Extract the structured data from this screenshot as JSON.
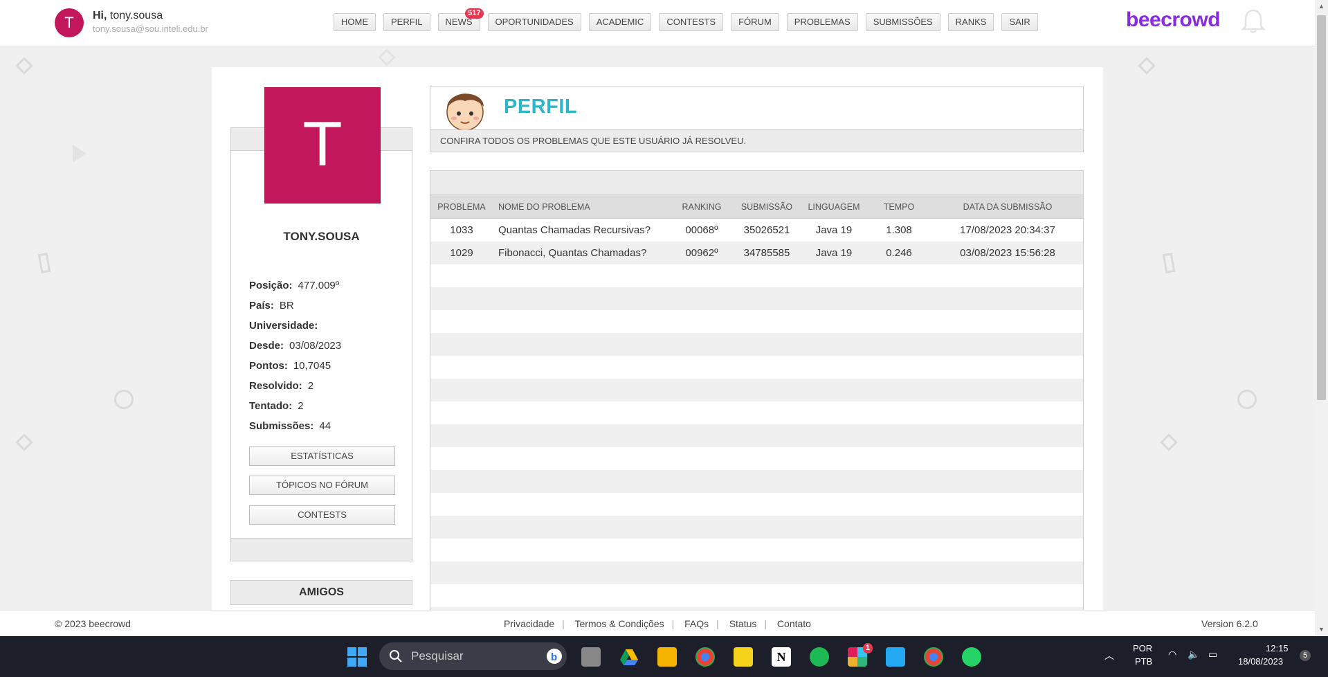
{
  "header": {
    "avatar_letter": "T",
    "greeting_prefix": "Hi,",
    "greeting_name": "tony.sousa",
    "email": "tony.sousa@sou.inteli.edu.br",
    "brand": "beecrowd",
    "nav": [
      {
        "label": "HOME"
      },
      {
        "label": "PERFIL"
      },
      {
        "label": "NEWS",
        "badge": "517"
      },
      {
        "label": "OPORTUNIDADES"
      },
      {
        "label": "ACADEMIC"
      },
      {
        "label": "CONTESTS"
      },
      {
        "label": "FÓRUM"
      },
      {
        "label": "PROBLEMAS"
      },
      {
        "label": "SUBMISSÕES"
      },
      {
        "label": "RANKS"
      },
      {
        "label": "SAIR"
      }
    ]
  },
  "profile": {
    "avatar_letter": "T",
    "username": "TONY.SOUSA",
    "stats": [
      {
        "label": "Posição:",
        "value": "477.009º"
      },
      {
        "label": "País:",
        "value": "BR"
      },
      {
        "label": "Universidade:",
        "value": ""
      },
      {
        "label": "Desde:",
        "value": "03/08/2023"
      },
      {
        "label": "Pontos:",
        "value": "10,7045"
      },
      {
        "label": "Resolvido:",
        "value": "2"
      },
      {
        "label": "Tentado:",
        "value": "2"
      },
      {
        "label": "Submissões:",
        "value": "44"
      }
    ],
    "buttons": [
      "ESTATÍSTICAS",
      "TÓPICOS NO FÓRUM",
      "CONTESTS"
    ],
    "friends_title": "AMIGOS"
  },
  "panel": {
    "title": "PERFIL",
    "subtitle": "CONFIRA TODOS OS PROBLEMAS QUE ESTE USUÁRIO JÁ RESOLVEU."
  },
  "table": {
    "headers": [
      "PROBLEMA",
      "NOME DO PROBLEMA",
      "RANKING",
      "SUBMISSÃO",
      "LINGUAGEM",
      "TEMPO",
      "DATA DA SUBMISSÃO"
    ],
    "rows": [
      [
        "1033",
        "Quantas Chamadas Recursivas?",
        "00068º",
        "35026521",
        "Java 19",
        "1.308",
        "17/08/2023 20:34:37"
      ],
      [
        "1029",
        "Fibonacci, Quantas Chamadas?",
        "00962º",
        "34785585",
        "Java 19",
        "0.246",
        "03/08/2023 15:56:28"
      ]
    ]
  },
  "footer": {
    "copyright": "© 2023 beecrowd",
    "links": [
      "Privacidade",
      "Termos & Condições",
      "FAQs",
      "Status",
      "Contato"
    ],
    "version": "Version 6.2.0"
  },
  "taskbar": {
    "search_placeholder": "Pesquisar",
    "lang_top": "POR",
    "lang_bottom": "PTB",
    "time": "12:15",
    "date": "18/08/2023",
    "notifications": "5",
    "slack_badge": "1"
  },
  "colors": {
    "avatar": "#c2185b",
    "brand": "#8a2be2",
    "panel_title": "#2bb7c9",
    "badge": "#e53950"
  }
}
